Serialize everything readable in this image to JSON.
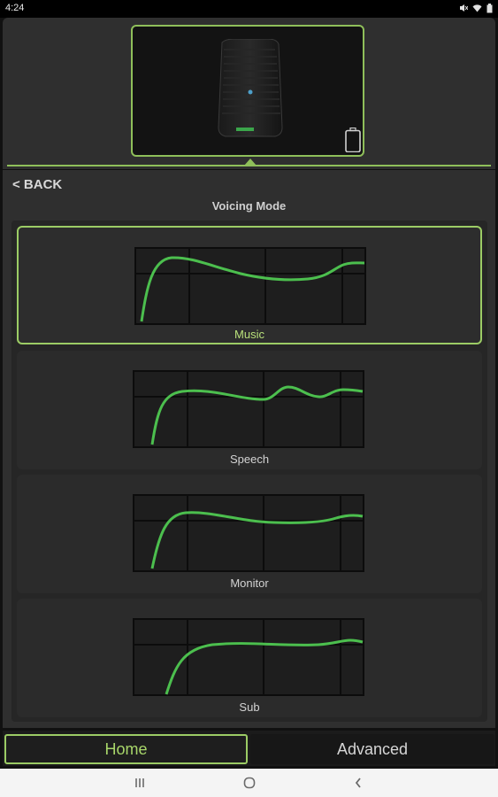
{
  "status_bar": {
    "time": "4:24",
    "icons": [
      "mute-icon",
      "wifi-icon",
      "battery-icon"
    ]
  },
  "header": {
    "device_name": "speaker-device-image",
    "battery_icon": "battery-outline-icon",
    "accent_color": "#9ccc65"
  },
  "navigation": {
    "back_label": "< BACK"
  },
  "section": {
    "title": "Voicing Mode"
  },
  "voicing_modes": [
    {
      "label": "Music",
      "selected": true
    },
    {
      "label": "Speech",
      "selected": false
    },
    {
      "label": "Monitor",
      "selected": false
    },
    {
      "label": "Sub",
      "selected": false
    }
  ],
  "tabs": {
    "home": "Home",
    "advanced": "Advanced",
    "active": "Home"
  },
  "android_nav": {
    "recents": "recents-icon",
    "home": "home-circle-icon",
    "back": "back-chevron-icon"
  }
}
